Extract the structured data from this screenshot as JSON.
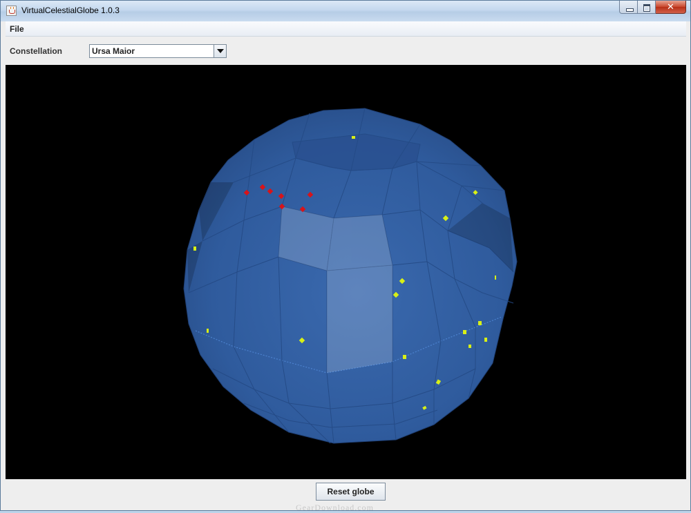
{
  "window": {
    "title": "VirtualCelestialGlobe 1.0.3",
    "close_glyph": "✕"
  },
  "menu": {
    "items": [
      {
        "label": "File"
      }
    ]
  },
  "controls": {
    "constellation_label": "Constellation",
    "constellation_selected": "Ursa Maior"
  },
  "actions": {
    "reset_label": "Reset globe"
  },
  "watermark": "GearDownload.com",
  "colors": {
    "canvas_bg": "#000000",
    "globe_fill": "#2f5a9c",
    "highlighted_star": "#d7141a",
    "star": "#d8f016"
  },
  "icons": {
    "app": "java-cup-icon",
    "minimize": "minimize-icon",
    "maximize": "maximize-icon",
    "close": "close-icon",
    "dropdown": "chevron-down-icon"
  }
}
